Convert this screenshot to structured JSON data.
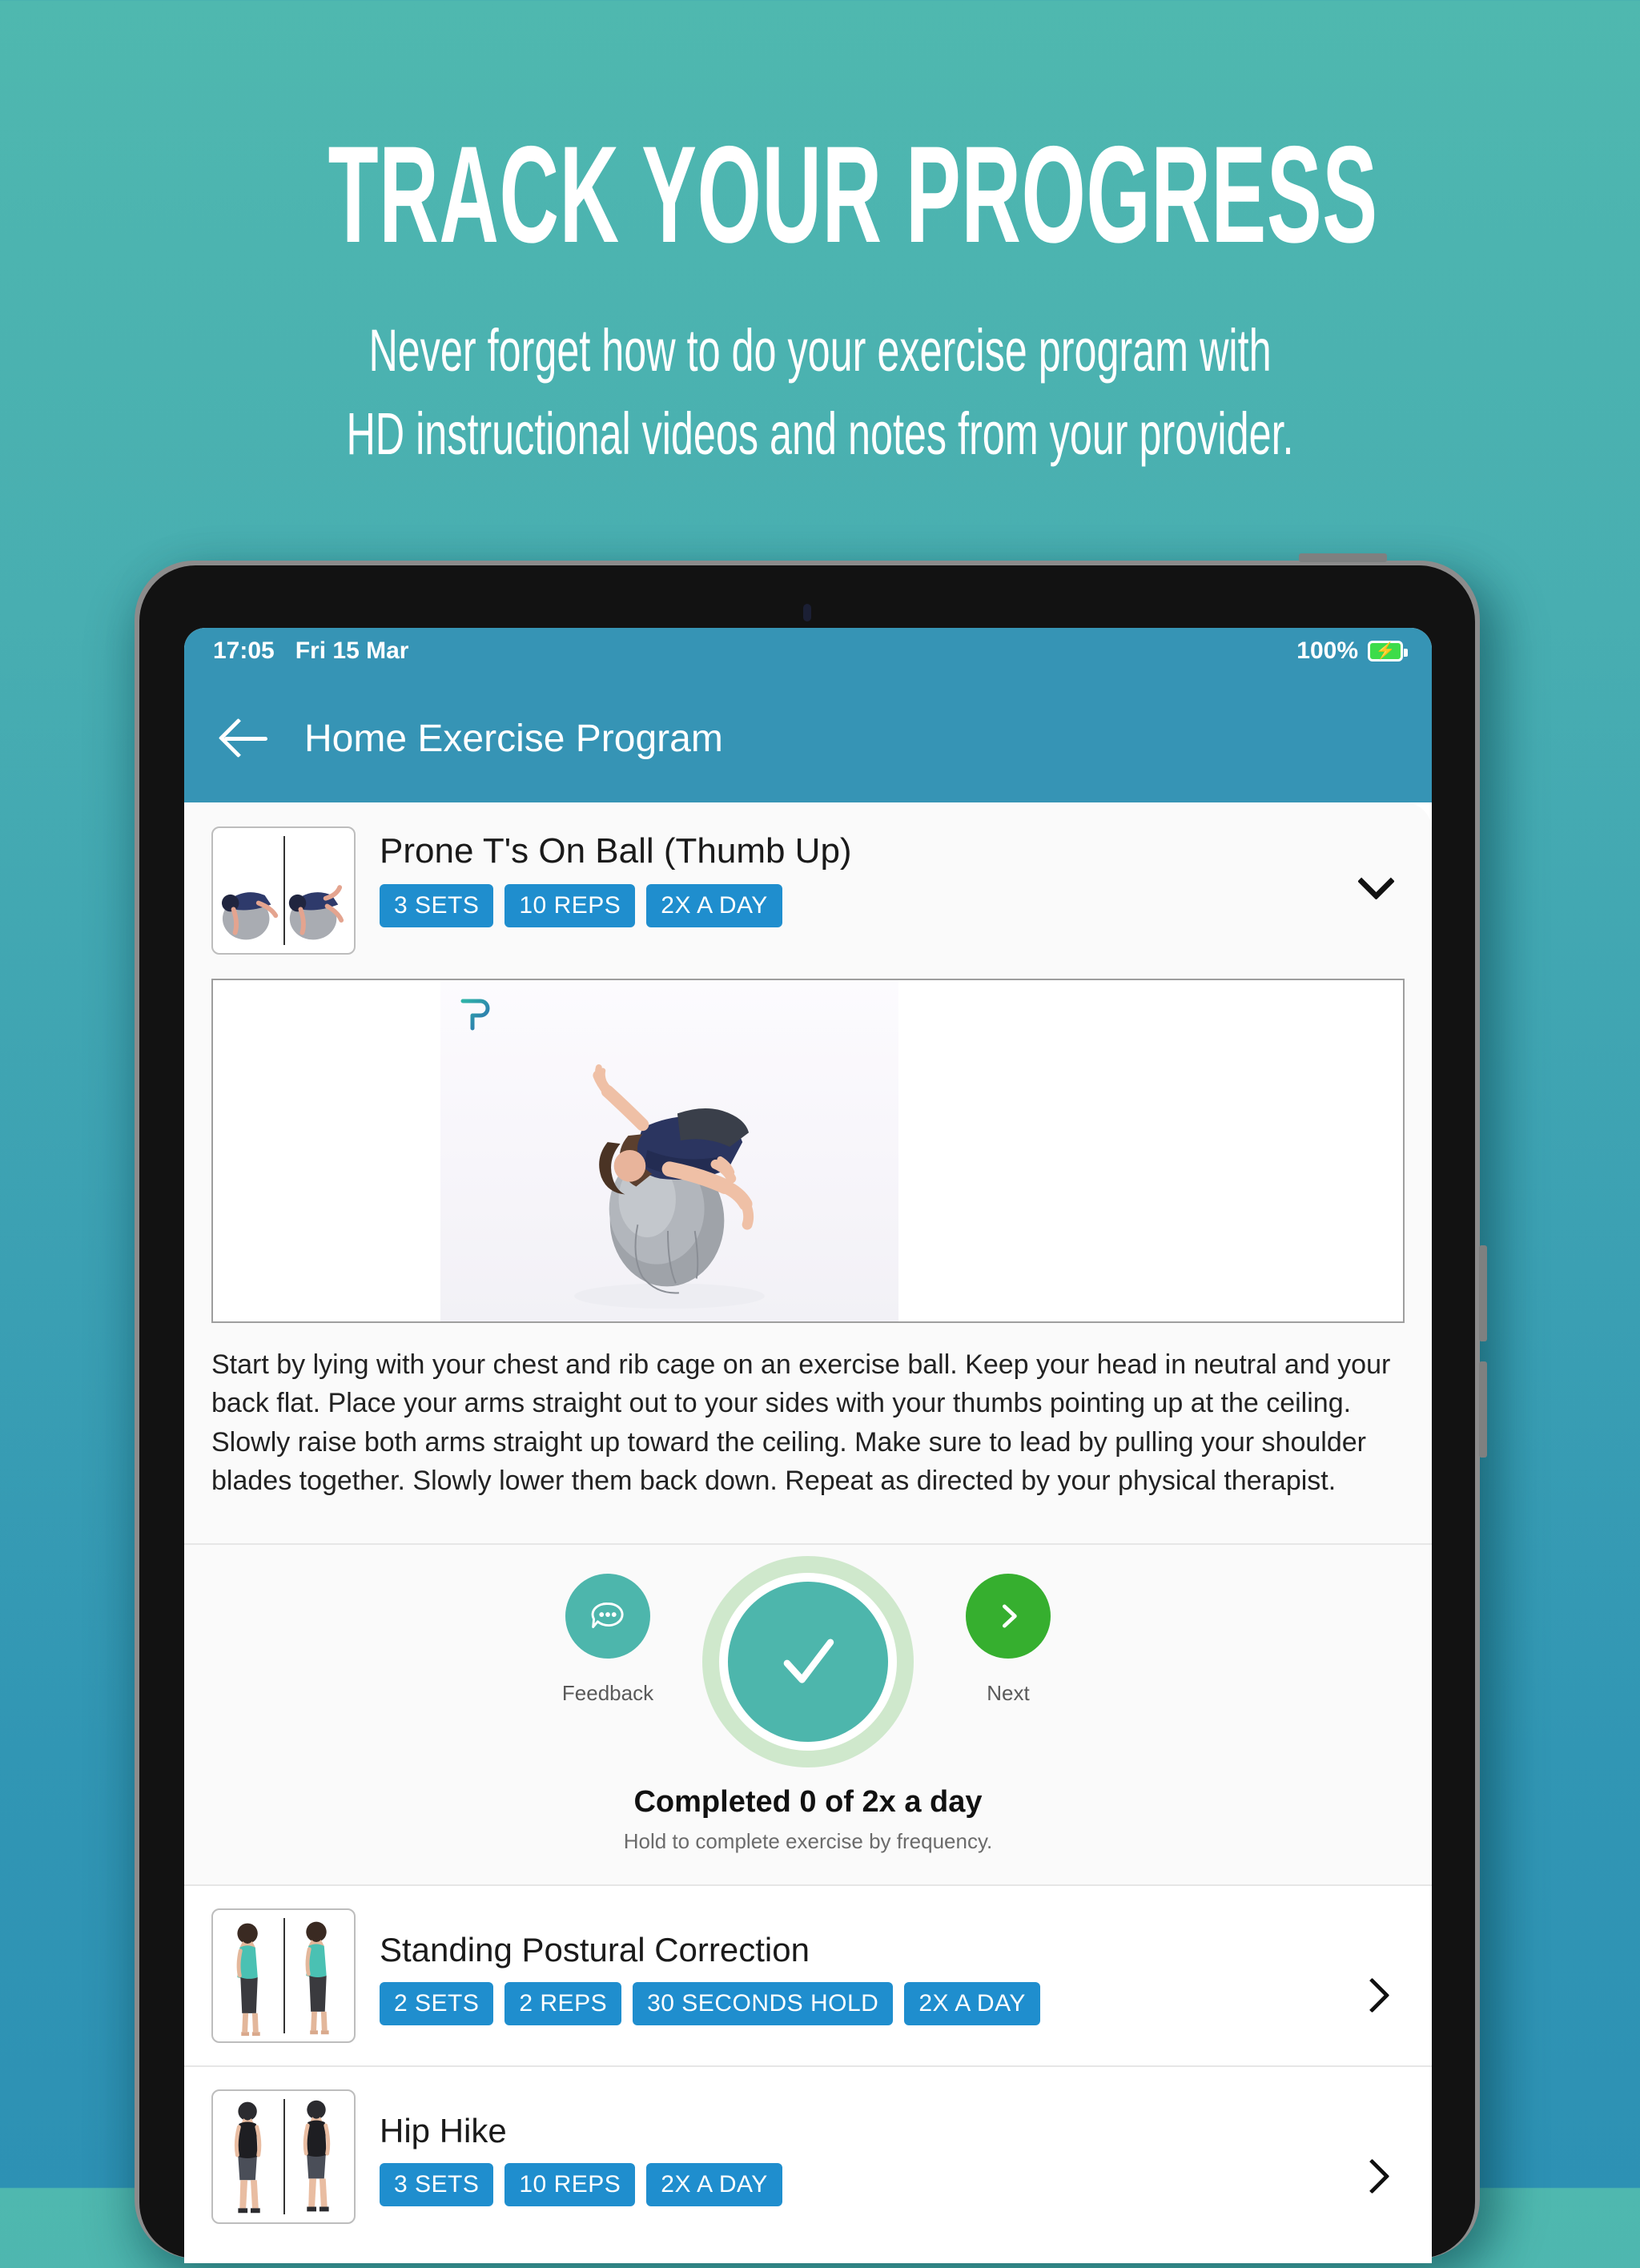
{
  "promo": {
    "headline": "TRACK YOUR PROGRESS",
    "subtitle_line1": "Never forget how to do your exercise program with",
    "subtitle_line2": "HD instructional videos and notes from your provider."
  },
  "colors": {
    "background_top": "#4FB8AF",
    "background_bottom": "#2D91B4",
    "header_bar": "#3694B5",
    "pill_blue": "#1F8ECE",
    "teal_accent": "#4DB6AC",
    "green_next": "#36AF2F",
    "ring_light_green": "#CFE8CC",
    "battery_green": "#3DDC4A"
  },
  "device": {
    "status_bar": {
      "time": "17:05",
      "date": "Fri 15 Mar",
      "battery_percent": "100%",
      "battery_icon": "battery-charging-icon",
      "bolt_glyph": "⚡"
    },
    "nav": {
      "back_icon": "arrow-left-icon",
      "title": "Home Exercise Program"
    }
  },
  "current_exercise": {
    "thumbnail_alt": "prone-ts-on-ball-thumbnail",
    "title": "Prone T's On Ball (Thumb Up)",
    "pills": [
      "3 SETS",
      "10 REPS",
      "2X A DAY"
    ],
    "expand_icon": "chevron-down-icon",
    "video": {
      "watermark": "physitrack-p-logo",
      "alt": "man lying prone on grey exercise ball with arms out to sides"
    },
    "description": "Start by lying with your chest and rib cage on an exercise ball. Keep your head in neutral and your back flat. Place your arms straight out to your sides with your thumbs pointing up at the ceiling. Slowly raise both arms straight up toward the ceiling. Make sure to lead by pulling your shoulder blades together. Slowly lower them back down. Repeat as directed by your physical therapist.",
    "actions": {
      "feedback_label": "Feedback",
      "feedback_icon": "chat-bubble-icon",
      "complete_icon": "check-icon",
      "next_label": "Next",
      "next_icon": "chevron-right-icon"
    },
    "status": {
      "completed_text": "Completed 0 of 2x a day",
      "hint_text": "Hold to complete exercise by frequency."
    }
  },
  "exercise_list": [
    {
      "title": "Standing Postural Correction",
      "pills": [
        "2 SETS",
        "2 REPS",
        "30 SECONDS HOLD",
        "2X A DAY"
      ],
      "chevron_icon": "chevron-right-icon",
      "thumbnail_alt": "standing-postural-correction-thumbnail"
    },
    {
      "title": "Hip Hike",
      "pills": [
        "3 SETS",
        "10 REPS",
        "2X A DAY"
      ],
      "chevron_icon": "chevron-right-icon",
      "thumbnail_alt": "hip-hike-thumbnail"
    }
  ]
}
